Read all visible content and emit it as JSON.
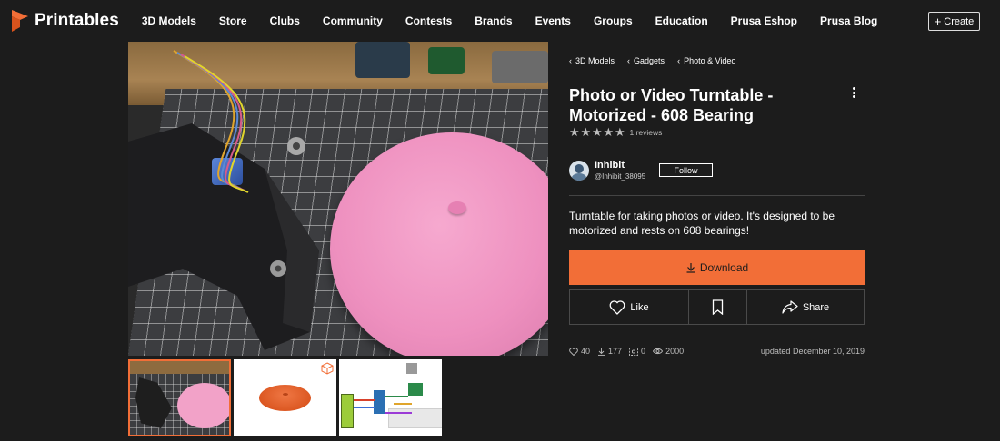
{
  "header": {
    "brand": "Printables",
    "nav": [
      "3D Models",
      "Store",
      "Clubs",
      "Community",
      "Contests",
      "Brands",
      "Events",
      "Groups",
      "Education",
      "Prusa Eshop",
      "Prusa Blog"
    ],
    "create_label": "Create",
    "accent_color": "#f26e37"
  },
  "breadcrumbs": [
    "3D Models",
    "Gadgets",
    "Photo & Video"
  ],
  "model": {
    "title": "Photo or Video Turntable - Motorized - 608 Bearing",
    "rating_stars": 5,
    "reviews_label": "1 reviews",
    "description": "Turntable for taking photos or video. It's designed to be motorized and rests on 608 bearings!"
  },
  "author": {
    "name": "Inhibit",
    "handle": "@Inhibit_38095",
    "follow_label": "Follow"
  },
  "actions": {
    "download_label": "Download",
    "like_label": "Like",
    "share_label": "Share"
  },
  "stats": {
    "likes": "40",
    "downloads": "177",
    "makes": "0",
    "views": "2000",
    "updated": "updated December 10, 2019"
  },
  "gallery": {
    "selected_index": 0,
    "thumbnails": [
      "photo-turntable",
      "render-disc",
      "wiring-diagram"
    ]
  }
}
